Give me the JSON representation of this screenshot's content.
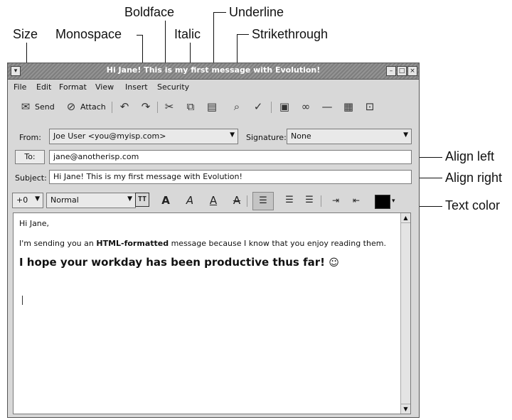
{
  "callouts": {
    "size": "Size",
    "monospace": "Monospace",
    "boldface": "Boldface",
    "italic": "Italic",
    "underline": "Underline",
    "strikethrough": "Strikethrough",
    "align_left": "Align left",
    "align_right": "Align right",
    "text_color": "Text color"
  },
  "window": {
    "title": "Hi Jane! This is my first message with Evolution!",
    "btn_minimize": "–",
    "btn_maximize": "□",
    "btn_close": "×"
  },
  "menubar": [
    "File",
    "Edit",
    "Format",
    "View",
    "Insert",
    "Security"
  ],
  "toolbar": {
    "send_label": "Send",
    "attach_label": "Attach"
  },
  "header": {
    "from_label": "From:",
    "from_value": "Joe User <you@myisp.com>",
    "signature_label": "Signature:",
    "signature_value": "None",
    "to_label": "To:",
    "to_value": "jane@anotherisp.com",
    "subject_label": "Subject:",
    "subject_value": "Hi Jane! This is my first message with Evolution!"
  },
  "format": {
    "size_value": "+0",
    "style_value": "Normal",
    "text_color": "#000000"
  },
  "message": {
    "greeting": "Hi Jane,",
    "line2_before": "I'm sending you an ",
    "line2_bold": "HTML-formatted",
    "line2_after": " message because I know that you enjoy reading them.",
    "headline": "I hope your workday has been productive thus far!",
    "smiley": "☺"
  }
}
